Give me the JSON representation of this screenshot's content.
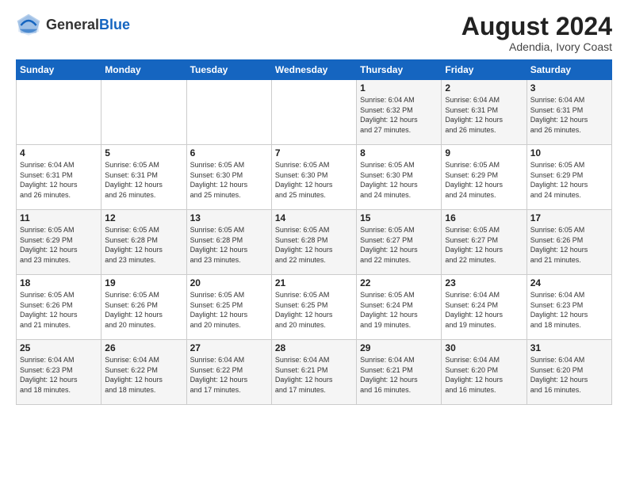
{
  "header": {
    "logo_general": "General",
    "logo_blue": "Blue",
    "month_year": "August 2024",
    "location": "Adendia, Ivory Coast"
  },
  "days_of_week": [
    "Sunday",
    "Monday",
    "Tuesday",
    "Wednesday",
    "Thursday",
    "Friday",
    "Saturday"
  ],
  "weeks": [
    [
      {
        "day": "",
        "info": ""
      },
      {
        "day": "",
        "info": ""
      },
      {
        "day": "",
        "info": ""
      },
      {
        "day": "",
        "info": ""
      },
      {
        "day": "1",
        "info": "Sunrise: 6:04 AM\nSunset: 6:32 PM\nDaylight: 12 hours\nand 27 minutes."
      },
      {
        "day": "2",
        "info": "Sunrise: 6:04 AM\nSunset: 6:31 PM\nDaylight: 12 hours\nand 26 minutes."
      },
      {
        "day": "3",
        "info": "Sunrise: 6:04 AM\nSunset: 6:31 PM\nDaylight: 12 hours\nand 26 minutes."
      }
    ],
    [
      {
        "day": "4",
        "info": "Sunrise: 6:04 AM\nSunset: 6:31 PM\nDaylight: 12 hours\nand 26 minutes."
      },
      {
        "day": "5",
        "info": "Sunrise: 6:05 AM\nSunset: 6:31 PM\nDaylight: 12 hours\nand 26 minutes."
      },
      {
        "day": "6",
        "info": "Sunrise: 6:05 AM\nSunset: 6:30 PM\nDaylight: 12 hours\nand 25 minutes."
      },
      {
        "day": "7",
        "info": "Sunrise: 6:05 AM\nSunset: 6:30 PM\nDaylight: 12 hours\nand 25 minutes."
      },
      {
        "day": "8",
        "info": "Sunrise: 6:05 AM\nSunset: 6:30 PM\nDaylight: 12 hours\nand 24 minutes."
      },
      {
        "day": "9",
        "info": "Sunrise: 6:05 AM\nSunset: 6:29 PM\nDaylight: 12 hours\nand 24 minutes."
      },
      {
        "day": "10",
        "info": "Sunrise: 6:05 AM\nSunset: 6:29 PM\nDaylight: 12 hours\nand 24 minutes."
      }
    ],
    [
      {
        "day": "11",
        "info": "Sunrise: 6:05 AM\nSunset: 6:29 PM\nDaylight: 12 hours\nand 23 minutes."
      },
      {
        "day": "12",
        "info": "Sunrise: 6:05 AM\nSunset: 6:28 PM\nDaylight: 12 hours\nand 23 minutes."
      },
      {
        "day": "13",
        "info": "Sunrise: 6:05 AM\nSunset: 6:28 PM\nDaylight: 12 hours\nand 23 minutes."
      },
      {
        "day": "14",
        "info": "Sunrise: 6:05 AM\nSunset: 6:28 PM\nDaylight: 12 hours\nand 22 minutes."
      },
      {
        "day": "15",
        "info": "Sunrise: 6:05 AM\nSunset: 6:27 PM\nDaylight: 12 hours\nand 22 minutes."
      },
      {
        "day": "16",
        "info": "Sunrise: 6:05 AM\nSunset: 6:27 PM\nDaylight: 12 hours\nand 22 minutes."
      },
      {
        "day": "17",
        "info": "Sunrise: 6:05 AM\nSunset: 6:26 PM\nDaylight: 12 hours\nand 21 minutes."
      }
    ],
    [
      {
        "day": "18",
        "info": "Sunrise: 6:05 AM\nSunset: 6:26 PM\nDaylight: 12 hours\nand 21 minutes."
      },
      {
        "day": "19",
        "info": "Sunrise: 6:05 AM\nSunset: 6:26 PM\nDaylight: 12 hours\nand 20 minutes."
      },
      {
        "day": "20",
        "info": "Sunrise: 6:05 AM\nSunset: 6:25 PM\nDaylight: 12 hours\nand 20 minutes."
      },
      {
        "day": "21",
        "info": "Sunrise: 6:05 AM\nSunset: 6:25 PM\nDaylight: 12 hours\nand 20 minutes."
      },
      {
        "day": "22",
        "info": "Sunrise: 6:05 AM\nSunset: 6:24 PM\nDaylight: 12 hours\nand 19 minutes."
      },
      {
        "day": "23",
        "info": "Sunrise: 6:04 AM\nSunset: 6:24 PM\nDaylight: 12 hours\nand 19 minutes."
      },
      {
        "day": "24",
        "info": "Sunrise: 6:04 AM\nSunset: 6:23 PM\nDaylight: 12 hours\nand 18 minutes."
      }
    ],
    [
      {
        "day": "25",
        "info": "Sunrise: 6:04 AM\nSunset: 6:23 PM\nDaylight: 12 hours\nand 18 minutes."
      },
      {
        "day": "26",
        "info": "Sunrise: 6:04 AM\nSunset: 6:22 PM\nDaylight: 12 hours\nand 18 minutes."
      },
      {
        "day": "27",
        "info": "Sunrise: 6:04 AM\nSunset: 6:22 PM\nDaylight: 12 hours\nand 17 minutes."
      },
      {
        "day": "28",
        "info": "Sunrise: 6:04 AM\nSunset: 6:21 PM\nDaylight: 12 hours\nand 17 minutes."
      },
      {
        "day": "29",
        "info": "Sunrise: 6:04 AM\nSunset: 6:21 PM\nDaylight: 12 hours\nand 16 minutes."
      },
      {
        "day": "30",
        "info": "Sunrise: 6:04 AM\nSunset: 6:20 PM\nDaylight: 12 hours\nand 16 minutes."
      },
      {
        "day": "31",
        "info": "Sunrise: 6:04 AM\nSunset: 6:20 PM\nDaylight: 12 hours\nand 16 minutes."
      }
    ]
  ]
}
